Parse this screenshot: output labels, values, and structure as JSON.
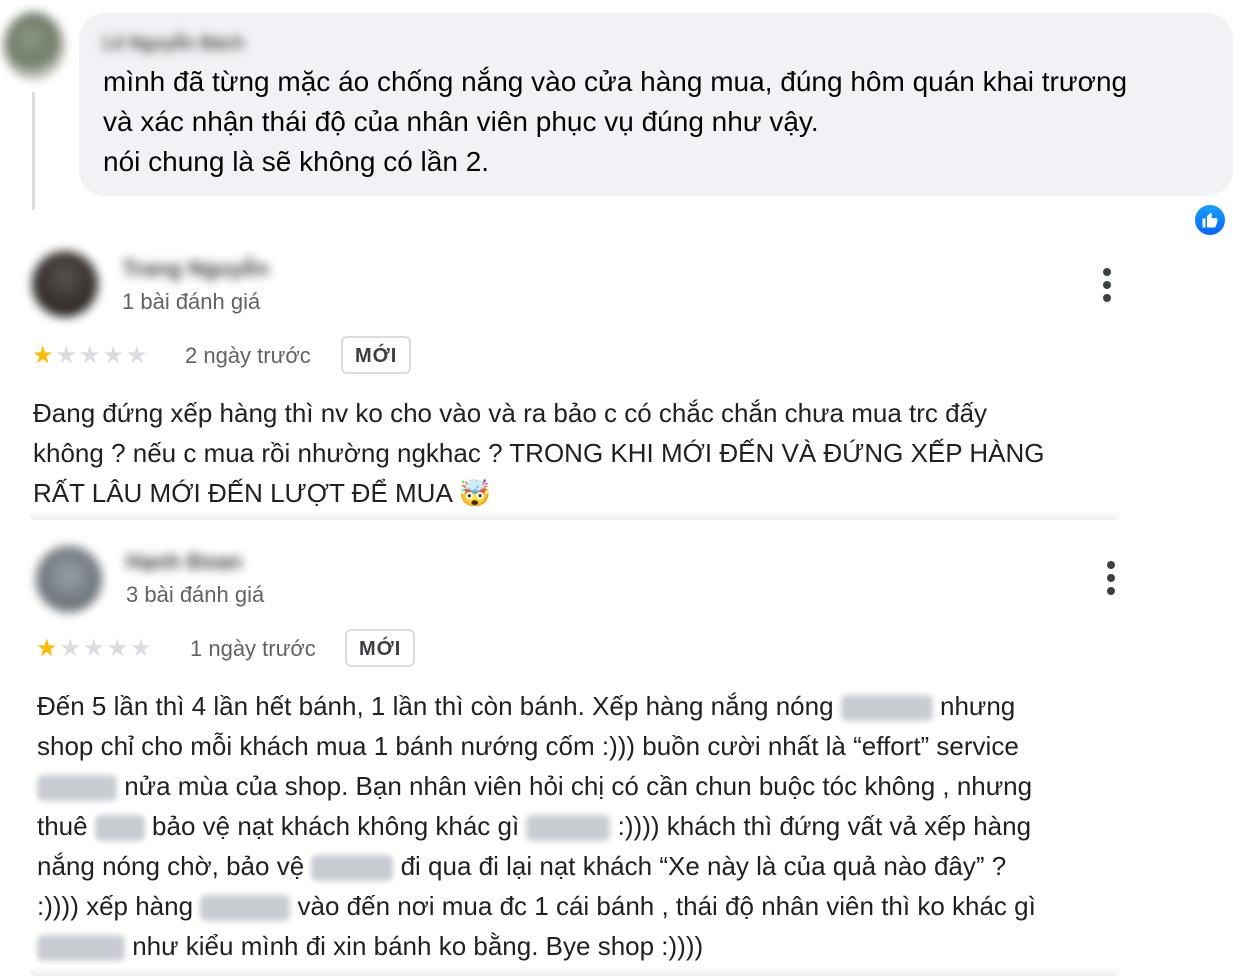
{
  "fb_comment": {
    "author": "Lê Nguyễn Bách",
    "text": "mình đã từng mặc áo chống nắng vào cửa hàng mua, đúng hôm quán khai trương\nvà xác nhận thái độ của nhân viên phục vụ đúng như vậy.\nnói chung là sẽ không có lần 2.",
    "reaction_icon": "like-icon"
  },
  "reviews": [
    {
      "author": "Trang Nguyễn",
      "review_count": "1 bài đánh giá",
      "rating": 1,
      "max_rating": 5,
      "time": "2 ngày trước",
      "badge": "MỚI",
      "text_line1": "Đang đứng xếp hàng thì nv ko cho vào và ra bảo c có chắc chắn chưa mua trc đấy",
      "text_line2": "không ? nếu c mua rồi nhường ngkhac ? TRONG KHI MỚI ĐẾN VÀ ĐỨNG XẾP HÀNG",
      "text_line3": "RẤT LÂU MỚI ĐẾN LƯỢT ĐỂ MUA",
      "emoji": "🤯"
    },
    {
      "author": "Hạnh Đoan",
      "review_count": "3 bài đánh giá",
      "rating": 1,
      "max_rating": 5,
      "time": "1 ngày trước",
      "badge": "MỚI",
      "l1a": "Đến 5 lần thì 4 lần hết bánh, 1 lần thì còn bánh. Xếp hàng nắng nóng ",
      "l1b": " nhưng",
      "l2": "shop chỉ cho mỗi khách mua 1 bánh nướng cốm :))) buồn cười nhất là “effort” service",
      "l3b": " nửa mùa của shop. Bạn nhân viên hỏi chị có cần chun buộc tóc không , nhưng",
      "l4a": "thuê ",
      "l4b": " bảo vệ nạt khách không khác gì ",
      "l4c": " :)))) khách thì đứng vất vả xếp hàng",
      "l5a": "nắng nóng chờ, bảo vệ ",
      "l5b": " đi qua đi lại nạt khách “Xe này là của quả nào đây” ?",
      "l6a": ":)))) xếp hàng ",
      "l6b": " vào đến nơi mua đc 1 cái bánh , thái độ nhân viên thì ko khác gì",
      "l7b": " như kiểu mình đi xin bánh ko bằng. Bye shop :))))"
    }
  ],
  "colors": {
    "star_on": "#fbbc04",
    "star_off": "#dadce0",
    "like_blue": "#0866ff",
    "bubble_bg": "#f0f2f5"
  },
  "icons": [
    "like-icon",
    "star-icon",
    "more-vert-icon"
  ]
}
